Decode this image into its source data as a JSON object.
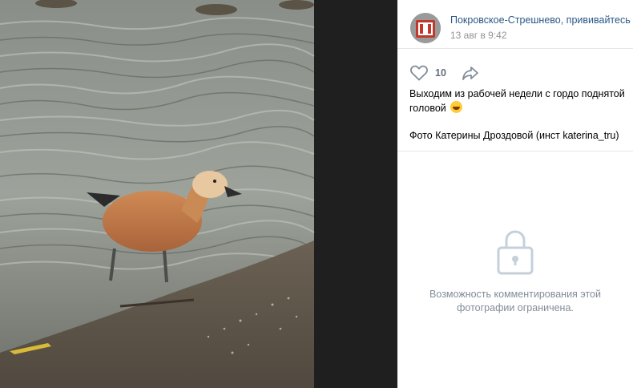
{
  "post": {
    "author_name": "Покровское-Стрешнево, прививайтесь",
    "date": "13 авг в 9:42",
    "likes": "10",
    "caption_line1": "Выходим из рабочей недели с гордо поднятой головой",
    "caption_line2": "Фото Катерины Дроздовой (инст katerina_tru)"
  },
  "comments": {
    "closed_text": "Возможность комментирования этой фотографии ограничена."
  },
  "icons": {
    "avatar": "community-logo",
    "like": "heart-icon",
    "share": "share-arrow-icon",
    "emoji": "grinning-emoji-icon",
    "lock": "lock-icon"
  },
  "colors": {
    "link": "#2a5885",
    "muted": "#939393",
    "hint": "#818c99",
    "divider": "#e7e8ec"
  }
}
